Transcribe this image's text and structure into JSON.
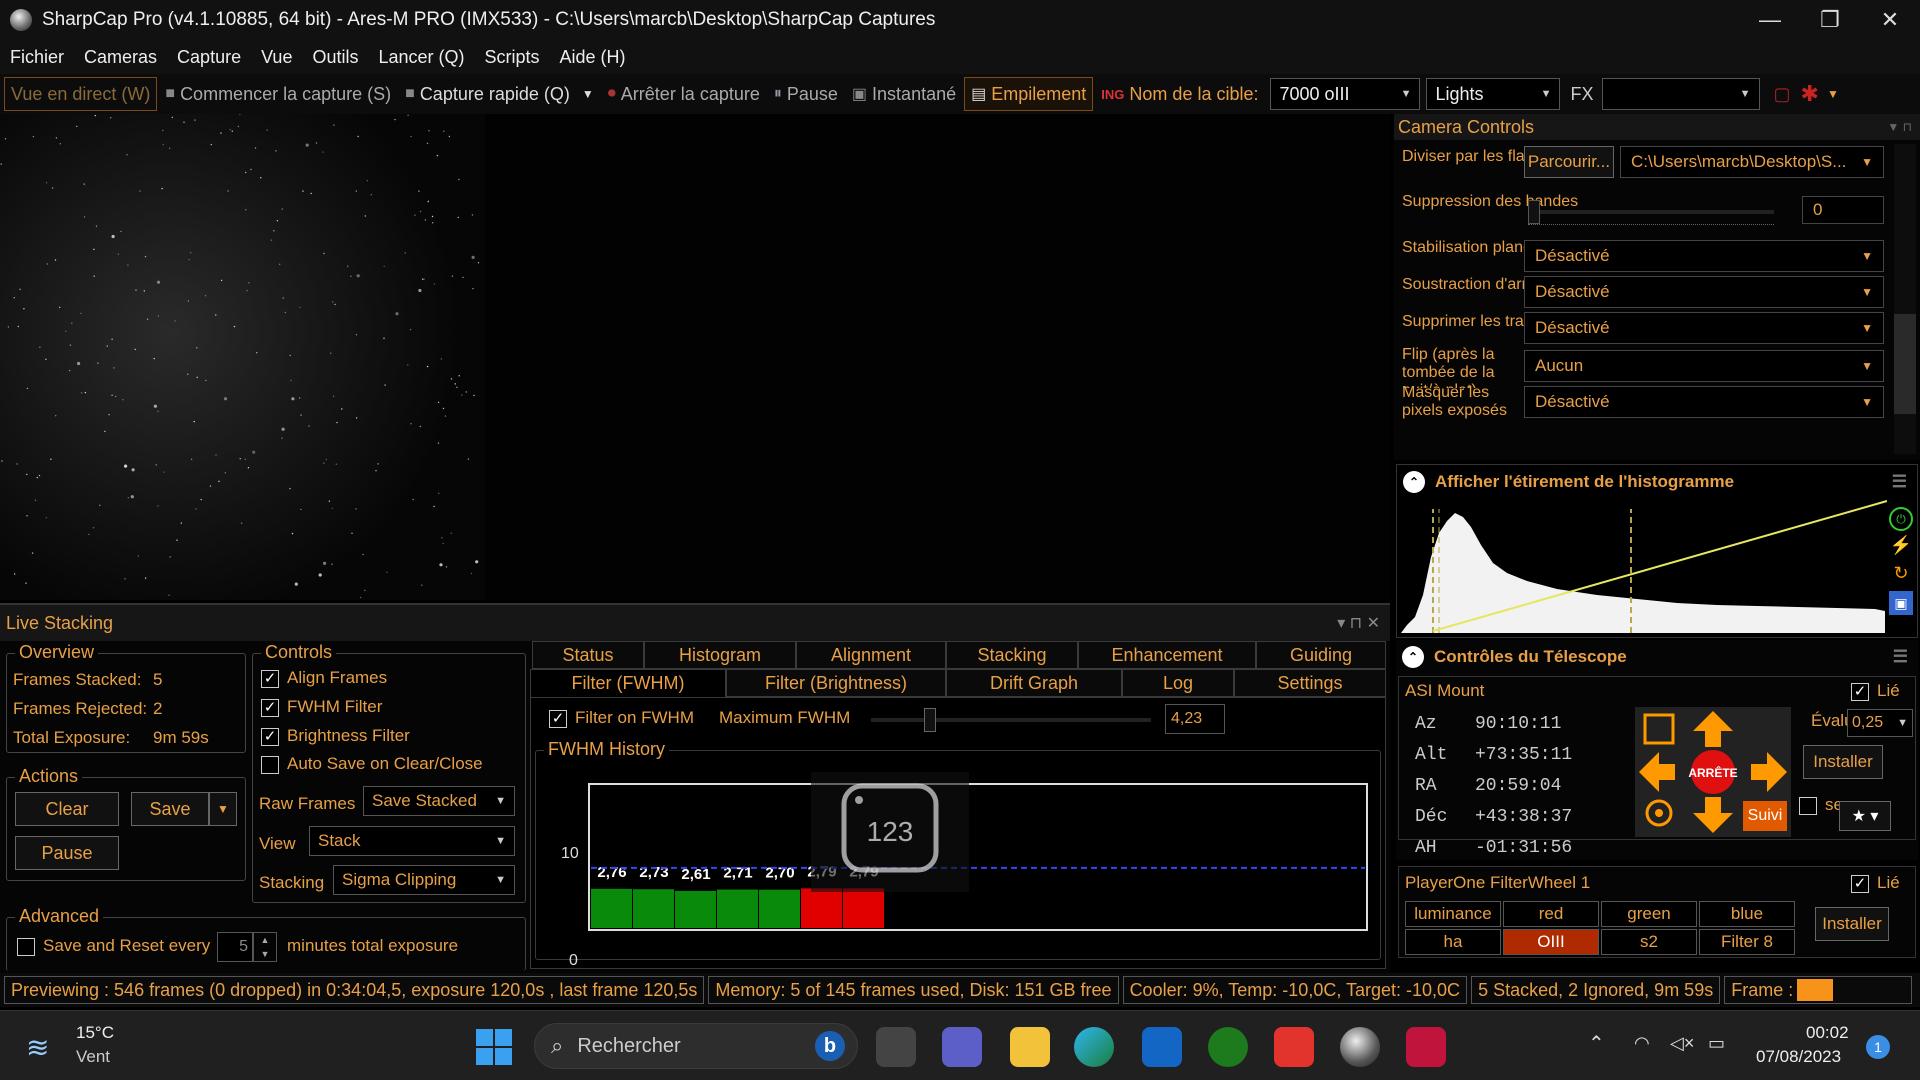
{
  "window": {
    "title": "SharpCap Pro (v4.1.10885, 64 bit) - Ares-M PRO (IMX533) - C:\\Users\\marcb\\Desktop\\SharpCap Captures"
  },
  "menu": [
    "Fichier",
    "Cameras",
    "Capture",
    "Vue",
    "Outils",
    "Lancer (Q)",
    "Scripts",
    "Aide (H)"
  ],
  "toolbar": {
    "live_view": "Vue en direct (W)",
    "start_capture": "Commencer la capture (S)",
    "quick_capture": "Capture rapide (Q)",
    "stop_capture": "Arrêter la capture",
    "pause": "Pause",
    "snapshot": "Instantané",
    "stacking": "Empilement",
    "target_label": "Nom de la cible:",
    "target_value": "7000 oIII",
    "frame_type": "Lights",
    "fx_label": "FX",
    "fx_value": ""
  },
  "live_stacking": {
    "title": "Live Stacking",
    "overview": {
      "title": "Overview",
      "frames_stacked_label": "Frames Stacked:",
      "frames_stacked": "5",
      "frames_rejected_label": "Frames Rejected:",
      "frames_rejected": "2",
      "total_exposure_label": "Total Exposure:",
      "total_exposure": "9m 59s"
    },
    "actions": {
      "title": "Actions",
      "clear": "Clear",
      "save": "Save",
      "pause": "Pause"
    },
    "advanced": {
      "title": "Advanced",
      "save_reset": "Save and Reset every",
      "minutes_value": "5",
      "minutes_suffix": "minutes total exposure"
    },
    "controls": {
      "title": "Controls",
      "align_frames": "Align Frames",
      "fwhm_filter": "FWHM Filter",
      "brightness_filter": "Brightness Filter",
      "auto_save": "Auto Save on Clear/Close",
      "raw_frames_label": "Raw Frames",
      "raw_frames_value": "Save Stacked",
      "view_label": "View",
      "view_value": "Stack",
      "stacking_label": "Stacking",
      "stacking_value": "Sigma Clipping"
    },
    "tabs_row1": [
      "Status",
      "Histogram",
      "Alignment",
      "Stacking",
      "Enhancement",
      "Guiding"
    ],
    "tabs_row2": [
      "Filter (FWHM)",
      "Filter (Brightness)",
      "Drift Graph",
      "Log",
      "Settings"
    ],
    "fwhm": {
      "filter_on_label": "Filter on FWHM",
      "max_label": "Maximum FWHM",
      "max_value": "4,23",
      "max_slider_fraction": 0.21,
      "history_title": "FWHM History",
      "y_max": "10",
      "y_min": "0",
      "bar_values": [
        "2,76",
        "2,73",
        "2,61",
        "2,71",
        "2,70",
        "2,79",
        "2,79"
      ],
      "bar_colors": [
        "#0a8a0a",
        "#0a8a0a",
        "#0a8a0a",
        "#0a8a0a",
        "#0a8a0a",
        "#e00000",
        "#e00000"
      ],
      "overlay_number": "123"
    }
  },
  "camera_controls": {
    "title": "Camera Controls",
    "rows": [
      {
        "label": "Diviser par les flats",
        "browse": "Parcourir...",
        "value": "C:\\Users\\marcb\\Desktop\\S..."
      },
      {
        "label": "Suppression des bandes",
        "value": "0"
      },
      {
        "label": "Stabilisation planète / disque",
        "value": "Désactivé"
      },
      {
        "label": "Soustraction d'arrière-plan",
        "value": "Désactivé"
      },
      {
        "label": "Supprimer les traces satellites",
        "value": "Désactivé"
      },
      {
        "label": "Flip (après la tombée de la nuit/à plat)",
        "value": "Aucun"
      },
      {
        "label": "Masquer les pixels exposés",
        "value": "Désactivé"
      }
    ]
  },
  "histogram": {
    "title": "Afficher l'étirement de l'histogramme"
  },
  "telescope": {
    "title": "Contrôles du Télescope",
    "mount": "ASI Mount",
    "linked": "Lié",
    "coords": [
      {
        "k": "Az",
        "v": "90:10:11"
      },
      {
        "k": "Alt",
        "v": "+73:35:11"
      },
      {
        "k": "RA",
        "v": "20:59:04"
      },
      {
        "k": "Déc",
        "v": "+43:38:37"
      },
      {
        "k": "AH",
        "v": "-01:31:56"
      }
    ],
    "stop": "ARRÊTE",
    "evaluate_label": "Évaluer:",
    "evaluate_value": "0,25",
    "install": "Installer",
    "park": "se garer",
    "track": "Suivi",
    "filterwheel": "PlayerOne FilterWheel 1",
    "filters": [
      "luminance",
      "red",
      "green",
      "blue",
      "ha",
      "OIII",
      "s2",
      "Filter 8"
    ],
    "fw_install": "Installer"
  },
  "status": {
    "preview": "Previewing : 546 frames (0 dropped) in 0:34:04,5, exposure 120,0s , last frame 120,5s",
    "memory": "Memory: 5 of 145 frames used, Disk: 151 GB free",
    "cooler": "Cooler: 9%, Temp: -10,0C, Target: -10,0C",
    "stacked": "5 Stacked, 2 Ignored, 9m 59s",
    "frame": "Frame :"
  },
  "taskbar": {
    "weather_temp": "15°C",
    "weather_desc": "Vent",
    "search_placeholder": "Rechercher",
    "time": "00:02",
    "date": "07/08/2023",
    "notif_count": "1"
  }
}
